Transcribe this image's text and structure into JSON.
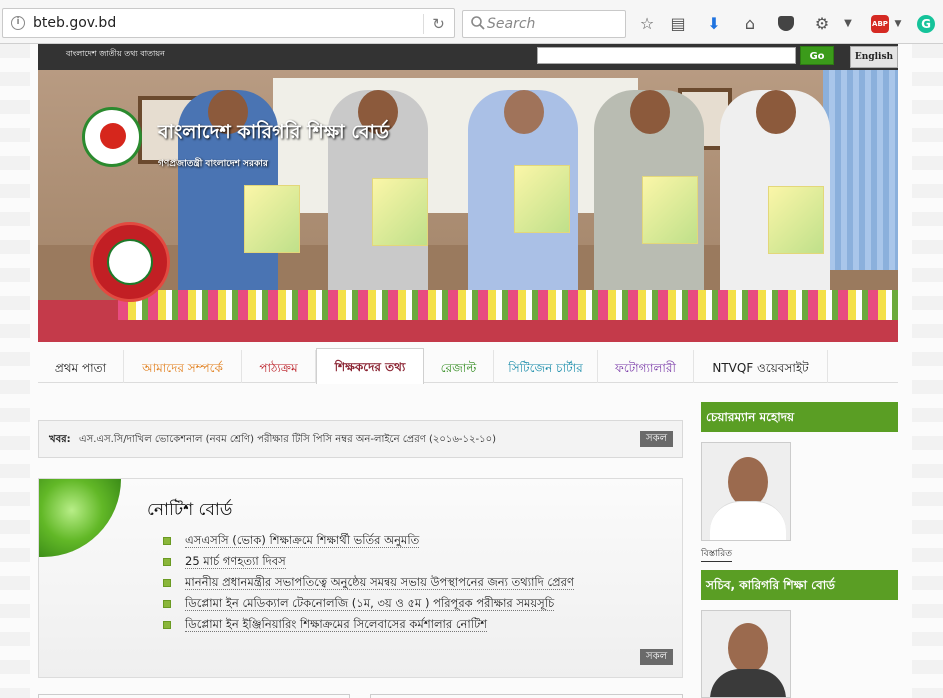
{
  "browser": {
    "url": "bteb.gov.bd",
    "search_placeholder": "Search",
    "abp_label": "ABP",
    "grammarly_label": "G"
  },
  "site": {
    "portal_link": "বাংলাদেশ জাতীয় তথ্য বাতায়ন",
    "go_label": "Go",
    "english_label": "English",
    "title": "বাংলাদেশ কারিগরি শিক্ষা বোর্ড",
    "subtitle": "গণপ্রজাতন্ত্রী বাংলাদেশ সরকার"
  },
  "nav": [
    {
      "label": "প্রথম পাতা",
      "color": "#222222"
    },
    {
      "label": "আমাদের সম্পর্কে",
      "color": "#e07b16"
    },
    {
      "label": "পাঠ্যক্রম",
      "color": "#b8131b"
    },
    {
      "label": "শিক্ষকদের তথ্য",
      "color": "#8a2332"
    },
    {
      "label": "রেজাল্ট",
      "color": "#2f8a1c"
    },
    {
      "label": "সিটিজেন চার্টার",
      "color": "#148aa8"
    },
    {
      "label": "ফটোগ্যালারী",
      "color": "#7a3aa8"
    },
    {
      "label": "NTVQF ওয়েবসাইট",
      "color": "#222222"
    }
  ],
  "news": {
    "label": "খবর:",
    "text": "এস.এস.সি/দাখিল ভোকেশনাল (নবম শ্রেণি) পরীক্ষার টিসি পিসি নম্বর অন-লাইনে প্রেরণ (২০১৬-১২-১০)",
    "all_label": "সকল"
  },
  "notice": {
    "title": "নোটিশ বোর্ড",
    "items": [
      "এসএসসি (ভোক) শিক্ষাক্রমে শিক্ষার্থী ভর্তির অনুমতি",
      "25 মার্চ গণহত্যা দিবস",
      "মাননীয় প্রধানমন্ত্রীর সভাপতিত্বে অনুষ্ঠেয় সমন্বয় সভায় উপস্থাপনের জন্য তথ্যাদি প্রেরণ",
      "ডিপ্লোমা ইন মেডিক্যাল টেকনোলজি (১ম, ৩য় ও ৫ম ) পরিপূরক পরীক্ষার সময়সূচি",
      "ডিপ্লোমা ইন ইঞ্জিনিয়ারিং শিক্ষাক্রমের সিলেবাসের কর্মশালার নোটিশ"
    ],
    "all_label": "সকল"
  },
  "sidebar": {
    "chairman_title": "চেয়ারম্যান মহোদয়",
    "details_label": "বিস্তারিত",
    "secretary_title": "সচিব, কারিগরি শিক্ষা বোর্ড"
  }
}
